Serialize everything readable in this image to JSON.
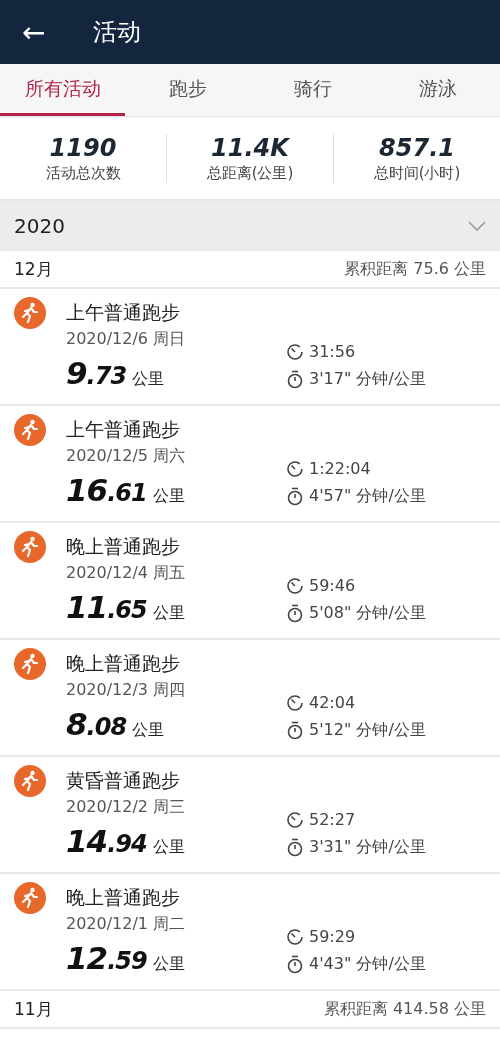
{
  "header": {
    "back": "←",
    "title": "活动"
  },
  "tabs": [
    {
      "label": "所有活动",
      "selected": true
    },
    {
      "label": "跑步",
      "selected": false
    },
    {
      "label": "骑行",
      "selected": false
    },
    {
      "label": "游泳",
      "selected": false
    }
  ],
  "stats": [
    {
      "value": "1190",
      "label": "活动总次数"
    },
    {
      "value": "11.4K",
      "label": "总距离(公里)"
    },
    {
      "value": "857.1",
      "label": "总时间(小时)"
    }
  ],
  "year": {
    "label": "2020",
    "expanded": true
  },
  "months": [
    {
      "month": "12月",
      "summary": "累积距离 75.6 公里",
      "activities": [
        {
          "title": "上午普通跑步",
          "date": "2020/12/6 周日",
          "distance_int": "9",
          "distance_dec": ".73",
          "unit": "公里",
          "duration": "31:56",
          "pace": "3'17\" 分钟/公里"
        },
        {
          "title": "上午普通跑步",
          "date": "2020/12/5 周六",
          "distance_int": "16",
          "distance_dec": ".61",
          "unit": "公里",
          "duration": "1:22:04",
          "pace": "4'57\" 分钟/公里"
        },
        {
          "title": "晚上普通跑步",
          "date": "2020/12/4 周五",
          "distance_int": "11",
          "distance_dec": ".65",
          "unit": "公里",
          "duration": "59:46",
          "pace": "5'08\" 分钟/公里"
        },
        {
          "title": "晚上普通跑步",
          "date": "2020/12/3 周四",
          "distance_int": "8",
          "distance_dec": ".08",
          "unit": "公里",
          "duration": "42:04",
          "pace": "5'12\" 分钟/公里"
        },
        {
          "title": "黄昏普通跑步",
          "date": "2020/12/2 周三",
          "distance_int": "14",
          "distance_dec": ".94",
          "unit": "公里",
          "duration": "52:27",
          "pace": "3'31\" 分钟/公里"
        },
        {
          "title": "晚上普通跑步",
          "date": "2020/12/1 周二",
          "distance_int": "12",
          "distance_dec": ".59",
          "unit": "公里",
          "duration": "59:29",
          "pace": "4'43\" 分钟/公里"
        }
      ]
    },
    {
      "month": "11月",
      "summary": "累积距离 414.58 公里"
    }
  ]
}
